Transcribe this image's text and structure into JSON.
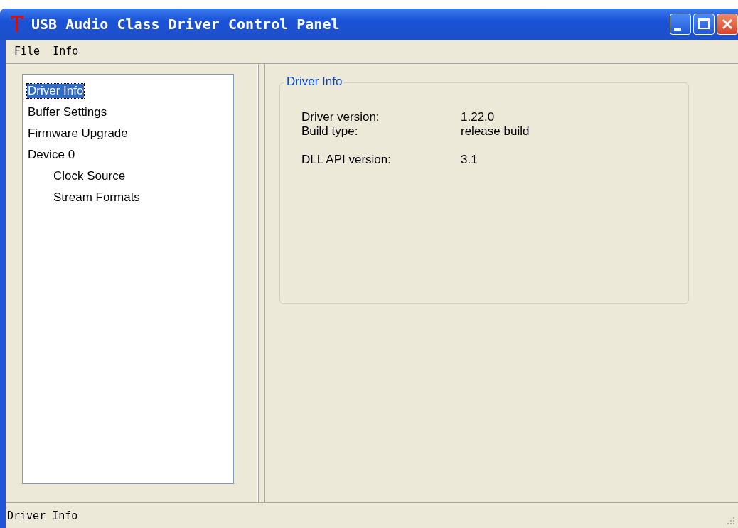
{
  "window": {
    "title": "USB Audio Class Driver Control Panel"
  },
  "menu": [
    "File",
    "Info"
  ],
  "tree": [
    {
      "label": "Driver Info",
      "selected": true
    },
    {
      "label": "Buffer Settings",
      "selected": false
    },
    {
      "label": "Firmware Upgrade",
      "selected": false
    },
    {
      "label": "Device 0",
      "selected": false,
      "children": [
        {
          "label": "Clock Source",
          "selected": false
        },
        {
          "label": "Stream Formats",
          "selected": false
        }
      ]
    }
  ],
  "group": {
    "title": "Driver Info",
    "sections": [
      [
        {
          "label": "Driver version:",
          "value": "1.22.0"
        },
        {
          "label": "Build type:",
          "value": "release build"
        }
      ],
      [
        {
          "label": "DLL API version:",
          "value": "3.1"
        }
      ]
    ]
  },
  "status_bar": "Driver Info"
}
